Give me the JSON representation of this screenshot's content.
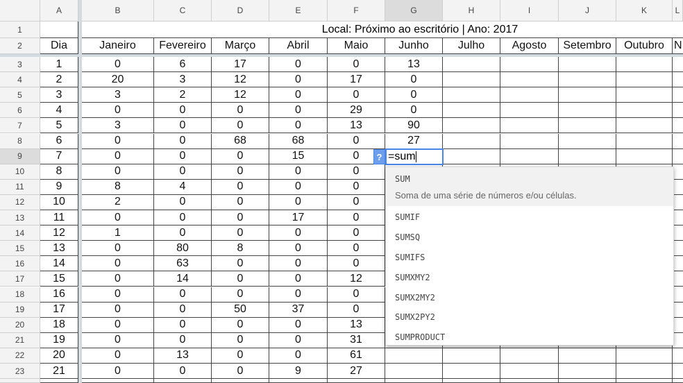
{
  "columns": [
    "A",
    "B",
    "C",
    "D",
    "E",
    "F",
    "G",
    "H",
    "I",
    "J",
    "K",
    "L"
  ],
  "selected_column": "G",
  "selected_row": 9,
  "title_row": "Local: Próximo ao escritório | Ano: 2017",
  "headers": [
    "Dia",
    "Janeiro",
    "Fevereiro",
    "Março",
    "Abril",
    "Maio",
    "Junho",
    "Julho",
    "Agosto",
    "Setembro",
    "Outubro",
    "N"
  ],
  "rows": [
    [
      "1",
      "0",
      "6",
      "17",
      "0",
      "0",
      "13"
    ],
    [
      "2",
      "20",
      "3",
      "12",
      "0",
      "17",
      "0"
    ],
    [
      "3",
      "3",
      "2",
      "12",
      "0",
      "0",
      "0"
    ],
    [
      "4",
      "0",
      "0",
      "0",
      "0",
      "29",
      "0"
    ],
    [
      "5",
      "3",
      "0",
      "0",
      "0",
      "13",
      "90"
    ],
    [
      "6",
      "0",
      "0",
      "68",
      "68",
      "0",
      "27"
    ],
    [
      "7",
      "0",
      "0",
      "0",
      "15",
      "0",
      ""
    ],
    [
      "8",
      "0",
      "0",
      "0",
      "0",
      "0",
      ""
    ],
    [
      "9",
      "8",
      "4",
      "0",
      "0",
      "0",
      ""
    ],
    [
      "10",
      "2",
      "0",
      "0",
      "0",
      "0",
      ""
    ],
    [
      "11",
      "0",
      "0",
      "0",
      "17",
      "0",
      ""
    ],
    [
      "12",
      "1",
      "0",
      "0",
      "0",
      "0",
      ""
    ],
    [
      "13",
      "0",
      "80",
      "8",
      "0",
      "0",
      ""
    ],
    [
      "14",
      "0",
      "63",
      "0",
      "0",
      "0",
      ""
    ],
    [
      "15",
      "0",
      "14",
      "0",
      "0",
      "12",
      ""
    ],
    [
      "16",
      "0",
      "0",
      "0",
      "0",
      "0",
      ""
    ],
    [
      "17",
      "0",
      "0",
      "50",
      "37",
      "0",
      ""
    ],
    [
      "18",
      "0",
      "0",
      "0",
      "0",
      "13",
      ""
    ],
    [
      "19",
      "0",
      "0",
      "0",
      "0",
      "31",
      ""
    ],
    [
      "20",
      "0",
      "13",
      "0",
      "0",
      "61",
      ""
    ],
    [
      "21",
      "0",
      "0",
      "0",
      "9",
      "27",
      ""
    ]
  ],
  "editor": {
    "value": "=sum",
    "help_label": "?"
  },
  "autocomplete": {
    "top": {
      "name": "SUM",
      "description": "Soma de uma série de números e/ou células."
    },
    "items": [
      "SUMIF",
      "SUMSQ",
      "SUMIFS",
      "SUMXMY2",
      "SUMX2MY2",
      "SUMX2PY2",
      "SUMPRODUCT"
    ]
  }
}
